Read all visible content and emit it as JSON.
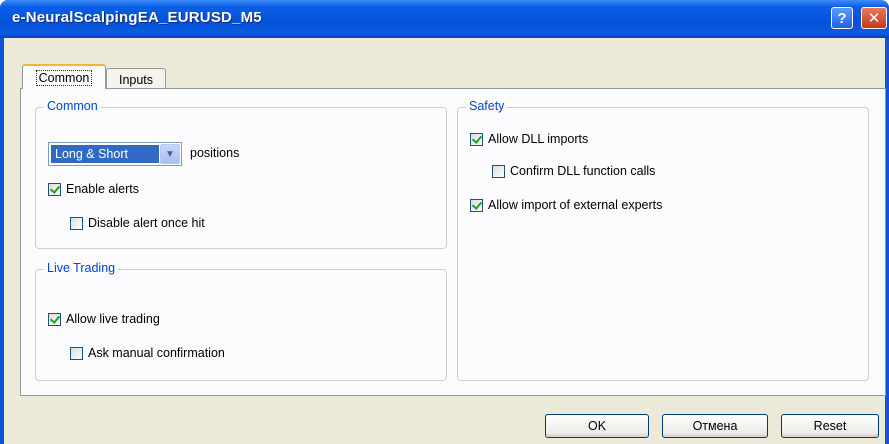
{
  "window": {
    "title": "e-NeuralScalpingEA_EURUSD_M5"
  },
  "titlebar": {
    "help_glyph": "?",
    "close_glyph": "✕"
  },
  "tabs": [
    {
      "label": "Common",
      "active": true
    },
    {
      "label": "Inputs",
      "active": false
    }
  ],
  "common_group": {
    "title": "Common",
    "positions_select": {
      "value": "Long & Short",
      "arrow": "▼"
    },
    "positions_label": "positions",
    "enable_alerts": {
      "label": "Enable alerts",
      "checked": true
    },
    "disable_alert_once_hit": {
      "label": "Disable alert once hit",
      "checked": false
    }
  },
  "live_trading_group": {
    "title": "Live Trading",
    "allow_live_trading": {
      "label": "Allow live trading",
      "checked": true
    },
    "ask_manual_confirmation": {
      "label": "Ask manual confirmation",
      "checked": false
    }
  },
  "safety_group": {
    "title": "Safety",
    "allow_dll_imports": {
      "label": "Allow DLL imports",
      "checked": true
    },
    "confirm_dll_calls": {
      "label": "Confirm DLL function calls",
      "checked": false
    },
    "allow_external_experts": {
      "label": "Allow import of external experts",
      "checked": true
    }
  },
  "buttons": {
    "ok": "OK",
    "cancel": "Отмена",
    "reset": "Reset"
  },
  "colors": {
    "titlebar": "#0550da",
    "group_title": "#0046d5",
    "selection": "#316ac5",
    "check": "#21a121"
  }
}
